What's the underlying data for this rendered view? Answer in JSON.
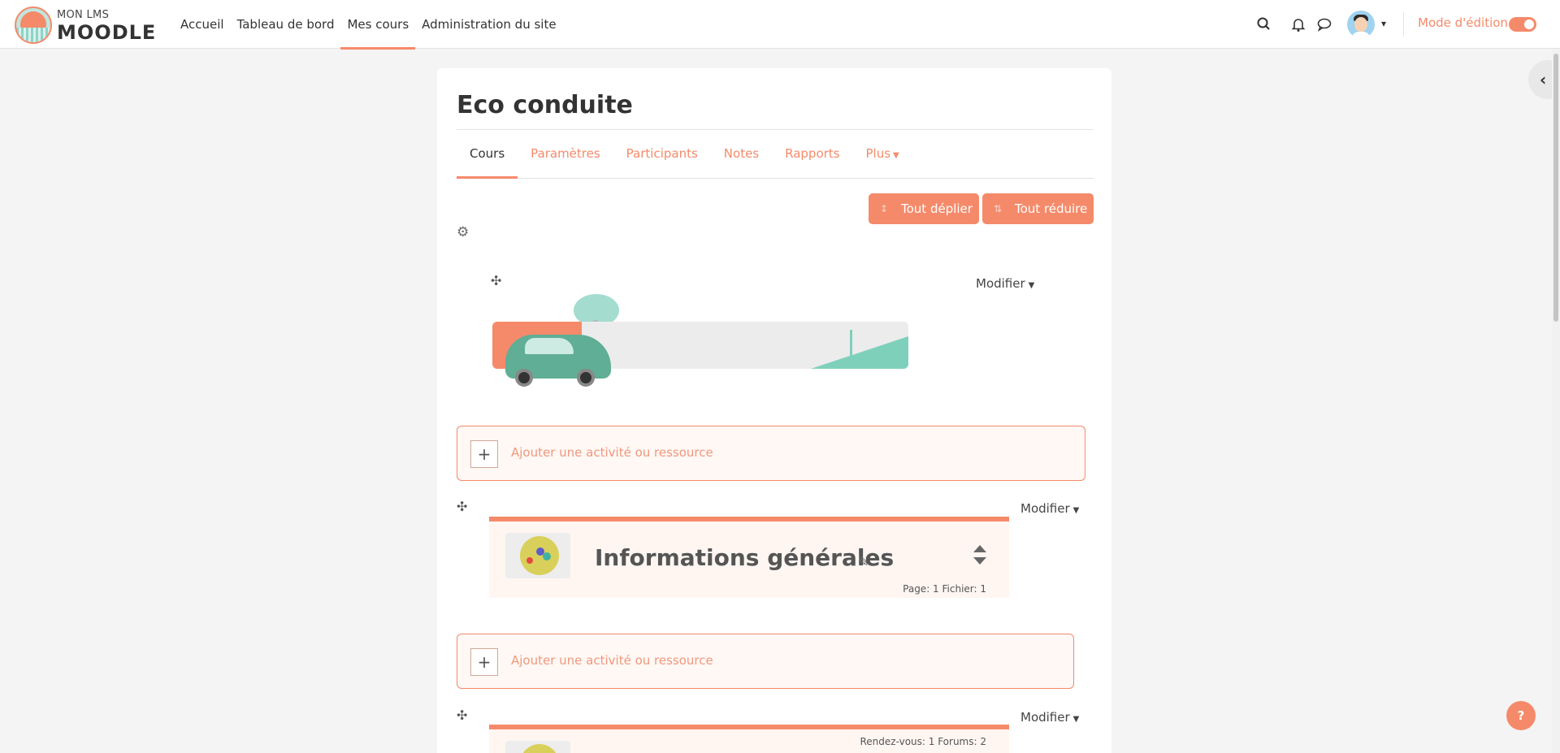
{
  "brand": {
    "top": "MON LMS",
    "main": "MOODLE"
  },
  "primary_nav": [
    {
      "label": "Accueil",
      "active": false
    },
    {
      "label": "Tableau de bord",
      "active": false
    },
    {
      "label": "Mes cours",
      "active": true
    },
    {
      "label": "Administration du site",
      "active": false
    }
  ],
  "header_right": {
    "edit_mode_label": "Mode d'édition",
    "edit_mode_on": true
  },
  "course": {
    "title": "Eco conduite",
    "tabs": [
      {
        "label": "Cours",
        "active": true
      },
      {
        "label": "Paramètres",
        "active": false
      },
      {
        "label": "Participants",
        "active": false
      },
      {
        "label": "Notes",
        "active": false
      },
      {
        "label": "Rapports",
        "active": false
      },
      {
        "label": "Plus",
        "active": false
      }
    ],
    "expand_all": "Tout déplier",
    "collapse_all": "Tout réduire",
    "modifier_label": "Modifier",
    "add_activity_label": "Ajouter une activité ou ressource",
    "sections": [
      {
        "title": "Informations générales",
        "counts": "Page: 1 Fichier: 1"
      },
      {
        "title": "",
        "counts": "Rendez-vous: 1 Forums: 2"
      }
    ]
  },
  "help_label": "?",
  "colors": {
    "accent": "#f58a6a",
    "section_bg": "#fff6f2"
  }
}
